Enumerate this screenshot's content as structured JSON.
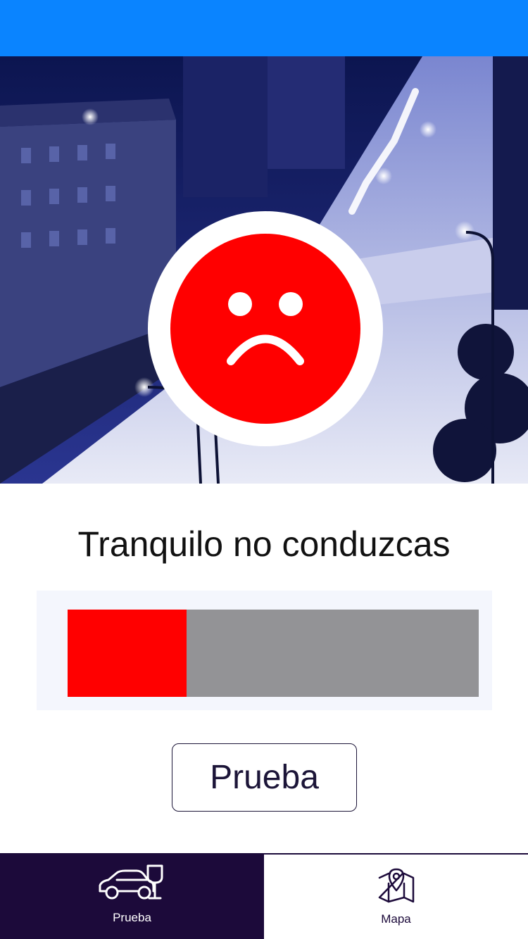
{
  "status_bar": {
    "color": "#0a84ff"
  },
  "hero": {
    "description_icon": "city-street-night-photo",
    "face_icon": "sad-face-icon",
    "face_color": "#ff0000"
  },
  "result": {
    "message": "Tranquilo no conduzcas"
  },
  "meter": {
    "level_fraction": 0.29,
    "fill_color": "#ff0000",
    "track_color": "#939396"
  },
  "actions": {
    "test_button_label": "Prueba"
  },
  "tab_bar": {
    "tabs": [
      {
        "label": "Prueba",
        "icon": "car-drink-icon",
        "active": true
      },
      {
        "label": "Mapa",
        "icon": "map-pin-icon",
        "active": false
      }
    ]
  }
}
